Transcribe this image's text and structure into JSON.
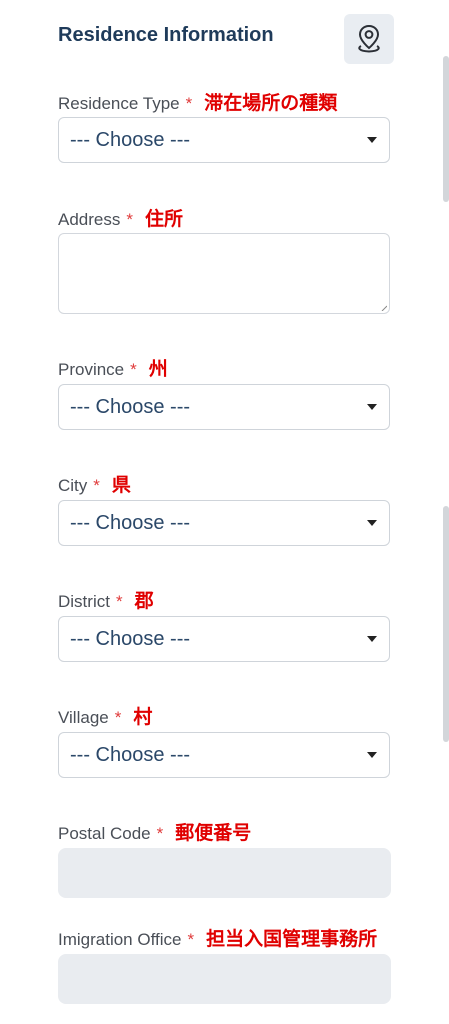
{
  "header": {
    "title": "Residence Information",
    "location_icon": "location-pin-icon"
  },
  "required_mark": "*",
  "fields": {
    "residence_type": {
      "label": "Residence Type",
      "jp": "滞在場所の種類",
      "value": "--- Choose ---"
    },
    "address": {
      "label": "Address",
      "jp": "住所",
      "value": ""
    },
    "province": {
      "label": "Province",
      "jp": "州",
      "value": "--- Choose ---"
    },
    "city": {
      "label": "City",
      "jp": "県",
      "value": "--- Choose ---"
    },
    "district": {
      "label": "District",
      "jp": "郡",
      "value": "--- Choose ---"
    },
    "village": {
      "label": "Village",
      "jp": "村",
      "value": "--- Choose ---"
    },
    "postal_code": {
      "label": "Postal Code",
      "jp": "郵便番号",
      "value": ""
    },
    "immigration_office": {
      "label": "Imigration Office",
      "jp": "担当入国管理事務所",
      "value": ""
    }
  },
  "colors": {
    "title": "#1f3b5a",
    "required": "#e03b3b",
    "annotation": "#e00000",
    "select_text": "#2b4869",
    "readonly_bg": "#e9ecf0"
  }
}
